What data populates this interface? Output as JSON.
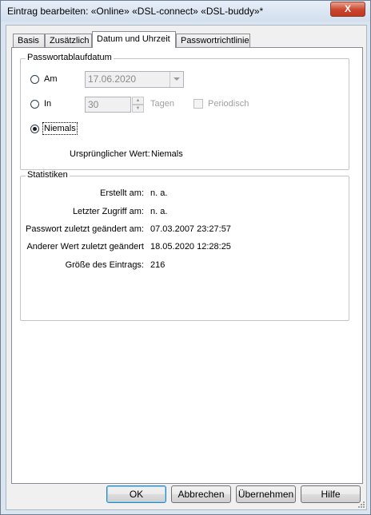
{
  "window": {
    "title": "Eintrag bearbeiten:  «Online» «DSL-connect» «DSL-buddy»*",
    "close_label": "X"
  },
  "tabs": [
    {
      "label": "Basis"
    },
    {
      "label": "Zusätzlich"
    },
    {
      "label": "Datum und Uhrzeit"
    },
    {
      "label": "Passwortrichtlinie"
    }
  ],
  "active_tab": "Datum und Uhrzeit",
  "expiry": {
    "group_label": "Passwortablaufdatum",
    "option_am": {
      "label": "Am",
      "checked": false
    },
    "date_value": "17.06.2020",
    "option_in": {
      "label": "In",
      "checked": false
    },
    "days_value": "30",
    "days_unit": "Tagen",
    "periodic": {
      "label": "Periodisch",
      "checked": false
    },
    "option_never": {
      "label": "Niemals",
      "checked": true
    },
    "original_label": "Ursprünglicher Wert:",
    "original_value": "Niemals"
  },
  "stats": {
    "group_label": "Statistiken",
    "rows": [
      {
        "label": "Erstellt am:",
        "value": "n. a."
      },
      {
        "label": "Letzter Zugriff am:",
        "value": "n. a."
      },
      {
        "label": "Passwort zuletzt geändert am:",
        "value": "07.03.2007 23:27:57"
      },
      {
        "label": "Anderer Wert zuletzt geändert",
        "value": "18.05.2020 12:28:25"
      },
      {
        "label": "Größe des Eintrags:",
        "value": "216"
      }
    ]
  },
  "buttons": {
    "ok": "OK",
    "cancel": "Abbrechen",
    "apply": "Übernehmen",
    "help": "Hilfe"
  }
}
